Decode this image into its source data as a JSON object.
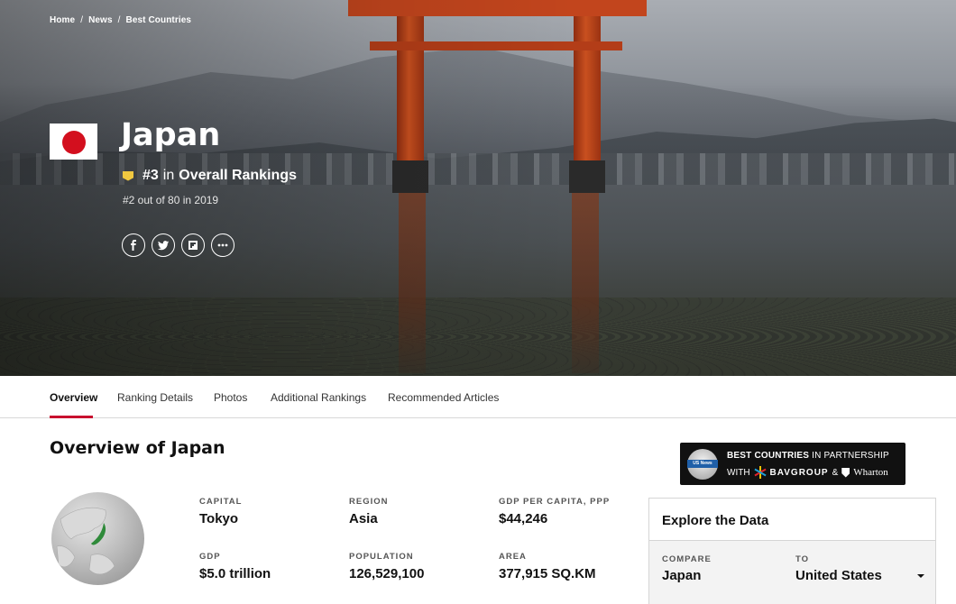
{
  "breadcrumb": [
    "Home",
    "News",
    "Best Countries"
  ],
  "breadcrumb_separator": "/",
  "country": {
    "name": "Japan",
    "rank": "#3",
    "rank_in": "in",
    "rank_category": "Overall Rankings",
    "prior_rank": "#2 out of 80 in 2019"
  },
  "social": [
    "facebook-icon",
    "twitter-icon",
    "flipboard-icon",
    "more-icon"
  ],
  "tabs": [
    {
      "label": "Overview",
      "active": true
    },
    {
      "label": "Ranking Details",
      "active": false
    },
    {
      "label": "Photos",
      "active": false
    },
    {
      "label": "Additional Rankings",
      "active": false
    },
    {
      "label": "Recommended Articles",
      "active": false
    }
  ],
  "overview": {
    "title": "Overview of Japan",
    "stats": [
      {
        "label": "CAPITAL",
        "value": "Tokyo"
      },
      {
        "label": "REGION",
        "value": "Asia"
      },
      {
        "label": "GDP PER CAPITA, PPP",
        "value": "$44,246"
      },
      {
        "label": "GDP",
        "value": "$5.0 trillion"
      },
      {
        "label": "POPULATION",
        "value": "126,529,100"
      },
      {
        "label": "AREA",
        "value": "377,915 SQ.KM"
      }
    ]
  },
  "partner": {
    "badge_text": "US News",
    "line1_bold": "BEST COUNTRIES",
    "line1_rest": "IN PARTNERSHIP",
    "line2_with": "WITH",
    "bav": "BAVGROUP",
    "amp": "&",
    "wharton": "Wharton"
  },
  "explore": {
    "title": "Explore the Data",
    "compare_label": "COMPARE",
    "compare_value": "Japan",
    "to_label": "TO",
    "to_value": "United States"
  },
  "colors": {
    "accent": "#c8102e",
    "flag_red": "#d30f1e",
    "rank_badge": "#f0c840",
    "torii": "#c2451d"
  }
}
